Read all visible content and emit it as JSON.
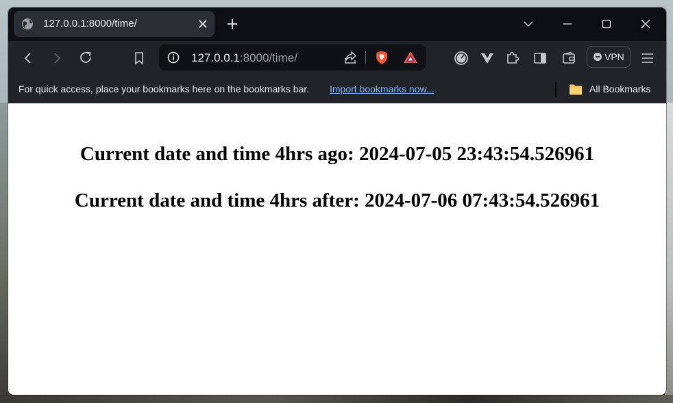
{
  "tab": {
    "title": "127.0.0.1:8000/time/"
  },
  "address_bar": {
    "host": "127.0.0.1",
    "rest": ":8000/time/"
  },
  "vpn": {
    "label": "VPN"
  },
  "bookmarks_bar": {
    "message": "For quick access, place your bookmarks here on the bookmarks bar.",
    "import_link": "Import bookmarks now...",
    "all_bookmarks": "All Bookmarks"
  },
  "page": {
    "line1": "Current date and time 4hrs ago: 2024-07-05 23:43:54.526961",
    "line2": "Current date and time 4hrs after: 2024-07-06 07:43:54.526961"
  },
  "icons": {
    "tab": [
      "globe-icon",
      "close-icon"
    ],
    "titlebar": [
      "new-tab-icon",
      "tab-search-chevron-icon",
      "minimize-icon",
      "maximize-icon",
      "close-window-icon"
    ],
    "toolbar": [
      "back-icon",
      "forward-icon",
      "reload-icon",
      "bookmark-icon",
      "site-info-icon",
      "share-icon",
      "brave-shields-icon",
      "brave-rewards-icon",
      "speedometer-icon",
      "vpn-shield-icon",
      "extensions-icon",
      "sidebar-icon",
      "wallet-icon",
      "menu-icon"
    ],
    "bookmarks": [
      "folder-icon"
    ]
  },
  "colors": {
    "titlebar": "#0d0f13",
    "toolbar": "#202328",
    "active_tab": "#2b2f35",
    "link": "#8ab4f8",
    "brave_orange": "#fb542b",
    "folder_yellow": "#f2c14e"
  }
}
